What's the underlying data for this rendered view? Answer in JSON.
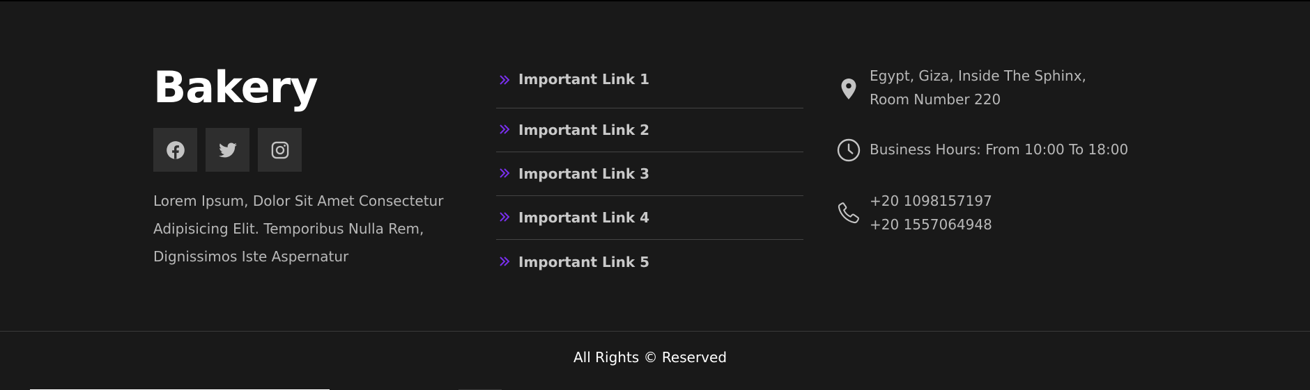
{
  "brand": {
    "title": "Bakery",
    "description": "Lorem Ipsum, Dolor Sit Amet Consectetur Adipisicing Elit. Temporibus Nulla Rem, Dignissimos Iste Aspernatur"
  },
  "socials": [
    {
      "icon": "facebook-icon"
    },
    {
      "icon": "twitter-icon"
    },
    {
      "icon": "instagram-icon"
    }
  ],
  "links": [
    {
      "label": "Important Link 1"
    },
    {
      "label": "Important Link 2"
    },
    {
      "label": "Important Link 3"
    },
    {
      "label": "Important Link 4"
    },
    {
      "label": "Important Link 5"
    }
  ],
  "contact": {
    "address": "Egypt, Giza, Inside The Sphinx, Room Number 220",
    "hours": "Business Hours: From 10:00 To 18:00",
    "phone_1": "+20 1098157197",
    "phone_2": "+20 1557064948"
  },
  "footer": {
    "copyright": "All Rights © Reserved"
  },
  "colors": {
    "background": "#191919",
    "accent": "#7a2ff0",
    "text_muted": "#b8b8b8",
    "social_bg": "#2e2e2e"
  }
}
